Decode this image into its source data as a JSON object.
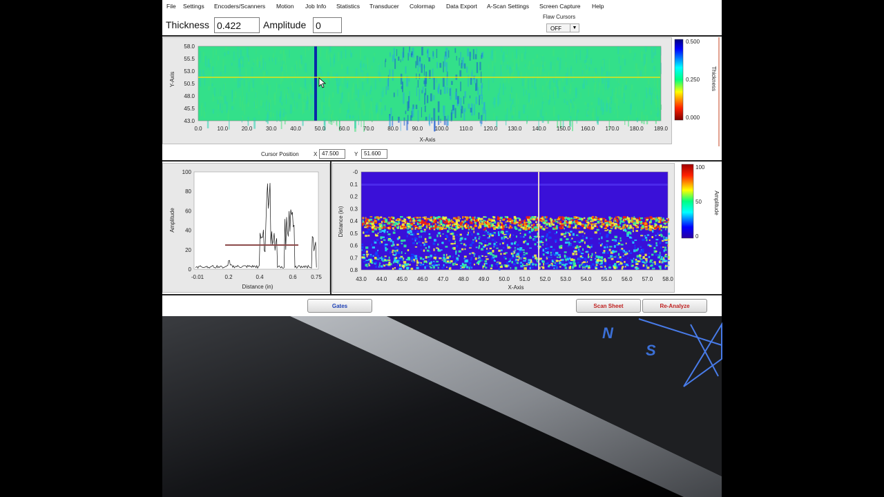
{
  "menu": [
    "File",
    "Settings",
    "Encoders/Scanners",
    "Motion",
    "Job Info",
    "Statistics",
    "Transducer",
    "Colormap",
    "Data Export",
    "A-Scan Settings",
    "Screen Capture",
    "Help"
  ],
  "readouts": {
    "thickness_label": "Thickness",
    "thickness_value": "0.422",
    "amplitude_label": "Amplitude",
    "amplitude_value": "0"
  },
  "flaw_cursors": {
    "label": "Flaw Cursors",
    "value": "OFF"
  },
  "cscan": {
    "y_axis_label": "Y-Axis",
    "x_axis_label": "X-Axis",
    "y_ticks": [
      "58.0",
      "55.5",
      "53.0",
      "50.5",
      "48.0",
      "45.5",
      "43.0"
    ],
    "x_ticks": [
      "0.0",
      "10.0",
      "20.0",
      "30.0",
      "40.0",
      "50.0",
      "60.0",
      "70.0",
      "80.0",
      "90.0",
      "100.0",
      "110.0",
      "120.0",
      "130.0",
      "140.0",
      "150.0",
      "160.0",
      "170.0",
      "180.0",
      "189.0"
    ],
    "colorbar_label": "Thickness",
    "colorbar_ticks": [
      "0.500",
      "0.250",
      "0.000"
    ]
  },
  "cursor_position": {
    "label": "Cursor Position",
    "x_label": "X",
    "x_value": "47.500",
    "y_label": "Y",
    "y_value": "51.600"
  },
  "ascan": {
    "y_axis_label": "Amplitude",
    "x_axis_label": "Distance (in)",
    "y_ticks": [
      "100",
      "80",
      "60",
      "40",
      "20",
      "0"
    ],
    "x_ticks": [
      "-0.01",
      "0.2",
      "0.4",
      "0.6",
      "0.75"
    ]
  },
  "bscan": {
    "y_axis_label": "Distance (in)",
    "x_axis_label": "X-Axis",
    "y_ticks": [
      "-0",
      "0.1",
      "0.2",
      "0.3",
      "0.4",
      "0.5",
      "0.6",
      "0.7",
      "0.8"
    ],
    "x_ticks": [
      "43.0",
      "44.0",
      "45.0",
      "46.0",
      "47.0",
      "48.0",
      "49.0",
      "50.0",
      "51.0",
      "52.0",
      "53.0",
      "54.0",
      "55.0",
      "56.0",
      "57.0",
      "58.0"
    ],
    "colorbar_label": "Amplitude",
    "colorbar_ticks": [
      "100",
      "50",
      "0"
    ]
  },
  "buttons": {
    "gates": "Gates",
    "scan_sheet": "Scan Sheet",
    "re_analyze": "Re-Analyze"
  },
  "colors": {
    "button_text_blue": "#1c3fb5",
    "button_text_red": "#c0201f",
    "cursor_line": "#e6e21a",
    "gate_line": "#8b4a4a"
  },
  "background_letters": [
    "N",
    "S"
  ]
}
